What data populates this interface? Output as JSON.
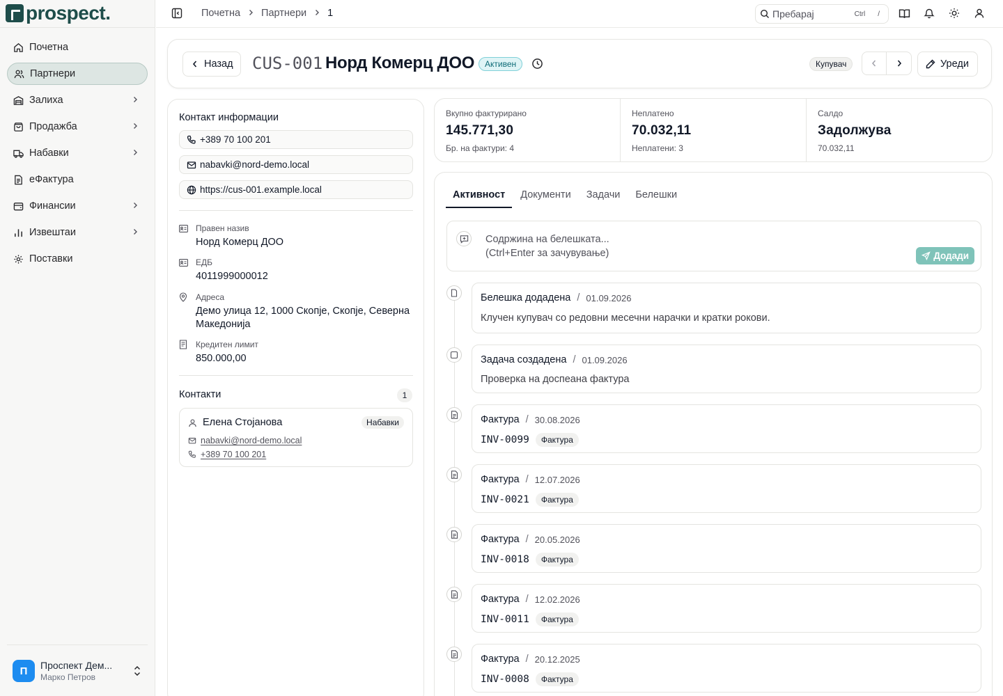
{
  "app": {
    "logo": "prospect."
  },
  "sidebar": {
    "items": [
      {
        "label": "Почетна",
        "icon": "home-icon",
        "chevron": false,
        "active": false
      },
      {
        "label": "Партнери",
        "icon": "users-icon",
        "chevron": false,
        "active": true
      },
      {
        "label": "Залиха",
        "icon": "warehouse-icon",
        "chevron": true,
        "active": false
      },
      {
        "label": "Продажба",
        "icon": "shopping-bag-icon",
        "chevron": true,
        "active": false
      },
      {
        "label": "Набавки",
        "icon": "truck-icon",
        "chevron": true,
        "active": false
      },
      {
        "label": "еФактура",
        "icon": "document-icon",
        "chevron": false,
        "active": false
      },
      {
        "label": "Финансии",
        "icon": "wallet-icon",
        "chevron": true,
        "active": false
      },
      {
        "label": "Извештаи",
        "icon": "bar-chart-icon",
        "chevron": true,
        "active": false
      },
      {
        "label": "Поставки",
        "icon": "gear-icon",
        "chevron": false,
        "active": false
      }
    ],
    "user": {
      "initial": "П",
      "name": "Проспект Дем...",
      "sub": "Марко Петров"
    }
  },
  "topbar": {
    "breadcrumbs": [
      "Почетна",
      "Партнери",
      "1"
    ],
    "search": {
      "placeholder": "Пребарај",
      "kbd1": "Ctrl",
      "kbd2": "/"
    }
  },
  "header": {
    "back_label": "Назад",
    "code": "CUS-001",
    "name": "Норд Комерц ДОО",
    "status": "Активен",
    "role": "Купувач",
    "edit_label": "Уреди"
  },
  "contact_info": {
    "title": "Контакт информации",
    "phone": "+389 70 100 201",
    "email": "nabavki@nord-demo.local",
    "website": "https://cus-001.example.local",
    "fields": {
      "legal_name_label": "Правен назив",
      "legal_name": "Норд Комерц ДОО",
      "edb_label": "ЕДБ",
      "edb": "4011999000012",
      "address_label": "Адреса",
      "address": "Демо улица 12, 1000 Скопје, Скопје, Северна Македонија",
      "credit_label": "Кредитен лимит",
      "credit": "850.000,00"
    },
    "contacts_title": "Контакти",
    "contacts_count": "1",
    "contact": {
      "name": "Елена Стојанова",
      "role": "Набавки",
      "email": "nabavki@nord-demo.local",
      "phone": "+389 70 100 201"
    }
  },
  "stats": [
    {
      "label": "Вкупно фактурирано",
      "value": "145.771,30",
      "sub": "Бр. на фактури: 4"
    },
    {
      "label": "Неплатено",
      "value": "70.032,11",
      "sub": "Неплатени: 3"
    },
    {
      "label": "Салдо",
      "value": "Задолжува",
      "sub": "70.032,11"
    }
  ],
  "activity": {
    "tabs": [
      "Активност",
      "Документи",
      "Задачи",
      "Белешки"
    ],
    "note_placeholder_1": "Содржина на белешката...",
    "note_placeholder_2": "(Ctrl+Enter за зачувување)",
    "add_label": "Додади",
    "items": [
      {
        "type": "note",
        "title": "Белешка додадена",
        "date": "01.09.2026",
        "body": "Клучен купувач со редовни месечни нарачки и кратки рокови."
      },
      {
        "type": "task",
        "title": "Задача создадена",
        "date": "01.09.2026",
        "body": "Проверка на доспеана фактура"
      },
      {
        "type": "invoice",
        "title": "Фактура",
        "date": "30.08.2026",
        "code": "INV-0099",
        "tag": "Фактура"
      },
      {
        "type": "invoice",
        "title": "Фактура",
        "date": "12.07.2026",
        "code": "INV-0021",
        "tag": "Фактура"
      },
      {
        "type": "invoice",
        "title": "Фактура",
        "date": "20.05.2026",
        "code": "INV-0018",
        "tag": "Фактура"
      },
      {
        "type": "invoice",
        "title": "Фактура",
        "date": "12.02.2026",
        "code": "INV-0011",
        "tag": "Фактура"
      },
      {
        "type": "invoice",
        "title": "Фактура",
        "date": "20.12.2025",
        "code": "INV-0008",
        "tag": "Фактура"
      }
    ]
  },
  "colors": {
    "brand": "#1e4d4a",
    "accent": "#7fc3b9",
    "active_badge": "#dff4f6",
    "avatar": "#1d8cf0"
  }
}
